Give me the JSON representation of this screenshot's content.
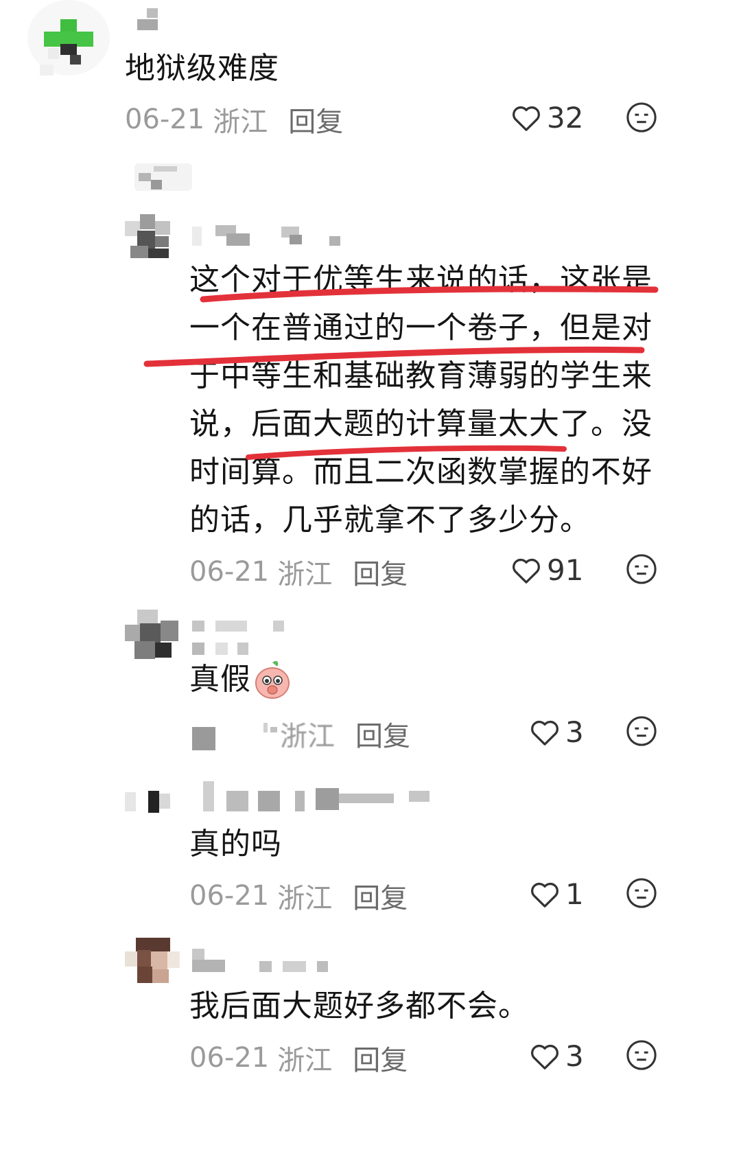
{
  "comments": [
    {
      "text": "地狱级难度",
      "date": "06-21",
      "location": "浙江",
      "reply_label": "回复",
      "likes": "32"
    },
    {
      "text": "这个对于优等生来说的话，这张是一个在普通过的一个卷子，但是对于中等生和基础教育薄弱的学生来说，后面大题的计算量太大了。没时间算。而且二次函数掌握的不好的话，几乎就拿不了多少分。",
      "lines": [
        "这个对于优等生来说的话，这张是",
        "一个在普通过的一个卷子，但是对",
        "于中等生和基础教育薄弱的学生来",
        "说，后面大题的计算量太大了。没",
        "时间算。而且二次函数掌握的不好",
        "的话，几乎就拿不了多少分。"
      ],
      "date": "06-21",
      "location": "浙江",
      "reply_label": "回复",
      "likes": "91"
    },
    {
      "text": "真假",
      "date_partial": "浙江",
      "reply_label": "回复",
      "likes": "3"
    },
    {
      "text": "真的吗",
      "date": "06-21",
      "location": "浙江",
      "reply_label": "回复",
      "likes": "1"
    },
    {
      "text": "我后面大题好多都不会。",
      "date": "06-21",
      "location": "浙江",
      "reply_label": "回复",
      "likes": "3"
    }
  ],
  "colors": {
    "highlight": "#e3313a",
    "meta_gray": "#9a9a9a",
    "text": "#151515"
  },
  "icons": {
    "like": "heart-outline-icon",
    "react": "neutral-face-icon",
    "sticker": "peach-sticker-icon"
  }
}
